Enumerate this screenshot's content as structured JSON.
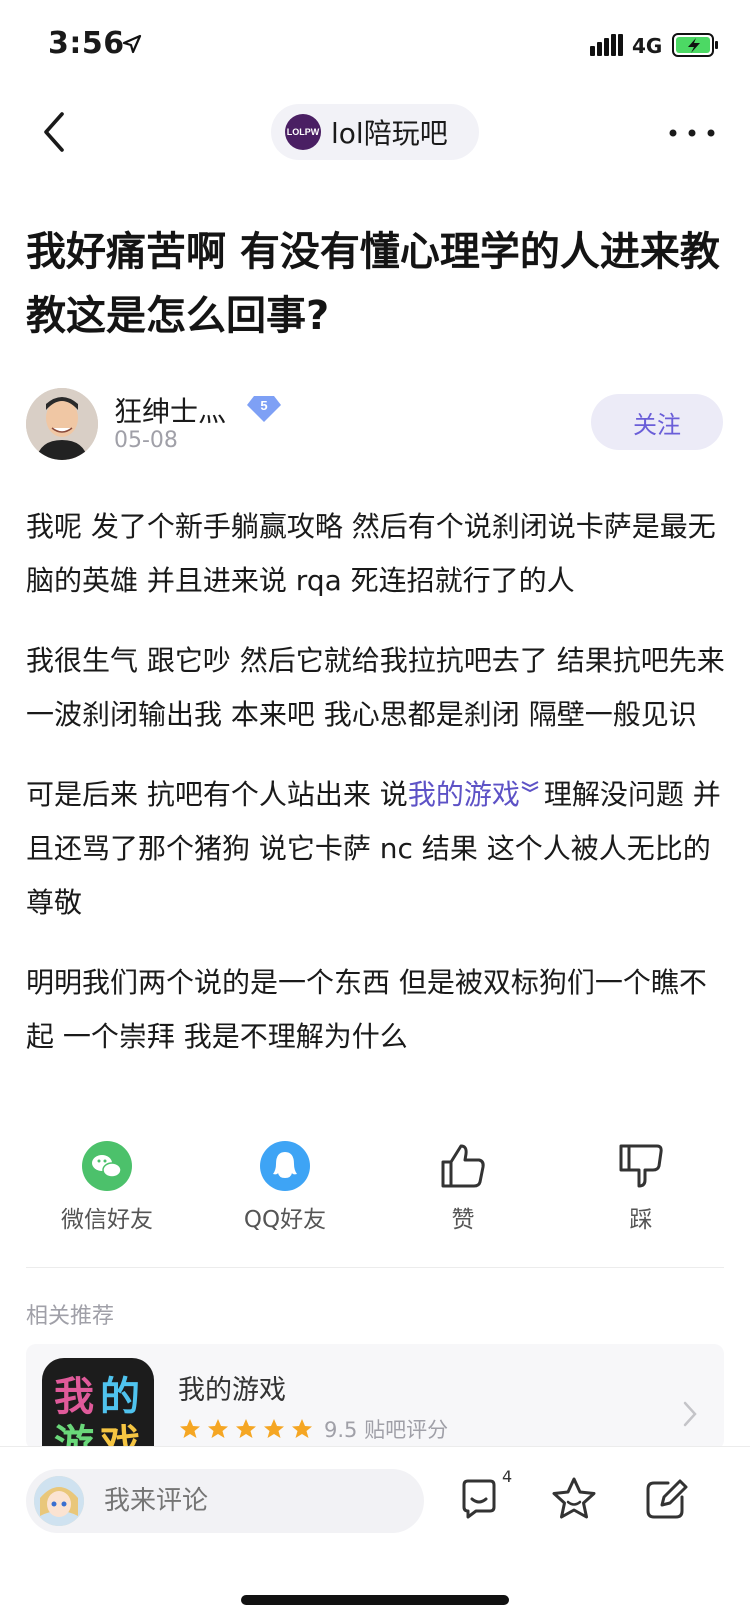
{
  "status_bar": {
    "time": "3:56",
    "network": "4G"
  },
  "nav": {
    "forum_name": "lol陪玩吧",
    "forum_logo_text": "LOLPW"
  },
  "post": {
    "title": "我好痛苦啊 有没有懂心理学的人进来教教这是怎么回事?",
    "author": {
      "name": "狂绅士灬",
      "level": "5",
      "date": "05-08"
    },
    "follow_label": "关注",
    "paragraphs": {
      "p1": "我呢 发了个新手躺赢攻略 然后有个说刹闭说卡萨是最无脑的英雄 并且进来说 rqa 死连招就行了的人",
      "p2": "我很生气 跟它吵 然后它就给我拉抗吧去了 结果抗吧先来一波刹闭输出我 本来吧 我心思都是刹闭 隔壁一般见识",
      "p3_before": "可是后来 抗吧有个人站出来 说",
      "p3_link": "我的游戏",
      "p3_after": "理解没问题 并且还骂了那个猪狗 说它卡萨 nc 结果 这个人被人无比的尊敬",
      "p4": "明明我们两个说的是一个东西 但是被双标狗们一个瞧不起 一个崇拜 我是不理解为什么"
    }
  },
  "actions": {
    "wechat": "微信好友",
    "qq": "QQ好友",
    "like": "赞",
    "dislike": "踩"
  },
  "related": {
    "title": "相关推荐",
    "game_name": "我的游戏",
    "game_icon_chars": [
      "我",
      "的",
      "游",
      "戏"
    ],
    "rating": 5,
    "rating_text": "9.5 贴吧评分"
  },
  "bottom_bar": {
    "comment_placeholder": "我来评论",
    "comment_count": "4"
  },
  "colors": {
    "accent": "#6a5ed8",
    "link": "#5d52c6",
    "wechat_green": "#4cc16b",
    "qq_blue": "#3ea4f5",
    "star_orange": "#f5a623"
  }
}
